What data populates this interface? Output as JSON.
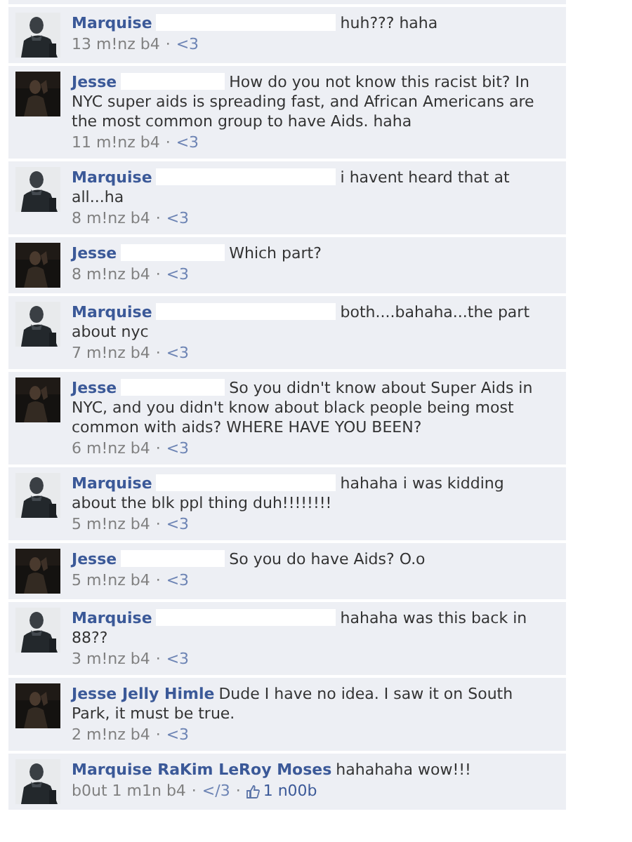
{
  "comments": [
    {
      "author": "Marquise",
      "avatar_dark": false,
      "redacted": true,
      "text": "huh??? haha",
      "meta": [
        {
          "kind": "time",
          "text": "13 m!nz b4"
        },
        {
          "kind": "dot",
          "text": "·"
        },
        {
          "kind": "link",
          "text": "<3"
        }
      ]
    },
    {
      "author": "Jesse",
      "avatar_dark": true,
      "redacted": true,
      "text": "How do you not know this racist bit? In NYC super aids is spreading fast, and African Americans are the most common group to have Aids. haha",
      "meta": [
        {
          "kind": "time",
          "text": "11 m!nz b4"
        },
        {
          "kind": "dot",
          "text": "·"
        },
        {
          "kind": "link",
          "text": "<3"
        }
      ]
    },
    {
      "author": "Marquise",
      "avatar_dark": false,
      "redacted": true,
      "text": "i havent heard that at all...ha",
      "meta": [
        {
          "kind": "time",
          "text": "8 m!nz b4"
        },
        {
          "kind": "dot",
          "text": "·"
        },
        {
          "kind": "link",
          "text": "<3"
        }
      ]
    },
    {
      "author": "Jesse",
      "avatar_dark": true,
      "redacted": true,
      "text": "Which part?",
      "meta": [
        {
          "kind": "time",
          "text": "8 m!nz b4"
        },
        {
          "kind": "dot",
          "text": "·"
        },
        {
          "kind": "link",
          "text": "<3"
        }
      ]
    },
    {
      "author": "Marquise",
      "avatar_dark": false,
      "redacted": true,
      "text": "both....bahaha...the part about nyc",
      "meta": [
        {
          "kind": "time",
          "text": "7 m!nz b4"
        },
        {
          "kind": "dot",
          "text": "·"
        },
        {
          "kind": "link",
          "text": "<3"
        }
      ]
    },
    {
      "author": "Jesse",
      "avatar_dark": true,
      "redacted": true,
      "text": "So you didn't know about Super Aids in NYC, and you didn't know about black people being most common with aids? WHERE HAVE YOU BEEN?",
      "meta": [
        {
          "kind": "time",
          "text": "6 m!nz b4"
        },
        {
          "kind": "dot",
          "text": "·"
        },
        {
          "kind": "link",
          "text": "<3"
        }
      ]
    },
    {
      "author": "Marquise",
      "avatar_dark": false,
      "redacted": true,
      "text": "hahaha i was kidding about the blk ppl thing duh!!!!!!!!",
      "meta": [
        {
          "kind": "time",
          "text": "5 m!nz b4"
        },
        {
          "kind": "dot",
          "text": "·"
        },
        {
          "kind": "link",
          "text": "<3"
        }
      ]
    },
    {
      "author": "Jesse",
      "avatar_dark": true,
      "redacted": true,
      "text": "So you do have Aids? O.o",
      "meta": [
        {
          "kind": "time",
          "text": "5 m!nz b4"
        },
        {
          "kind": "dot",
          "text": "·"
        },
        {
          "kind": "link",
          "text": "<3"
        }
      ]
    },
    {
      "author": "Marquise",
      "avatar_dark": false,
      "redacted": true,
      "text": "hahaha was this back in 88??",
      "meta": [
        {
          "kind": "time",
          "text": "3 m!nz b4"
        },
        {
          "kind": "dot",
          "text": "·"
        },
        {
          "kind": "link",
          "text": "<3"
        }
      ]
    },
    {
      "author": "Jesse Jelly Himle",
      "avatar_dark": true,
      "redacted": false,
      "text": "Dude I have no idea. I saw it on South Park, it must be true.",
      "meta": [
        {
          "kind": "time",
          "text": "2 m!nz b4"
        },
        {
          "kind": "dot",
          "text": "·"
        },
        {
          "kind": "link",
          "text": "<3"
        }
      ]
    },
    {
      "author": "Marquise RaKim LeRoy Moses",
      "avatar_dark": false,
      "redacted": false,
      "text": "hahahaha wow!!!",
      "meta": [
        {
          "kind": "time",
          "text": "b0ut 1 m1n b4"
        },
        {
          "kind": "dot",
          "text": "·"
        },
        {
          "kind": "link",
          "text": "</3"
        },
        {
          "kind": "dot",
          "text": "·"
        },
        {
          "kind": "like",
          "text": "1 n00b"
        }
      ]
    }
  ]
}
